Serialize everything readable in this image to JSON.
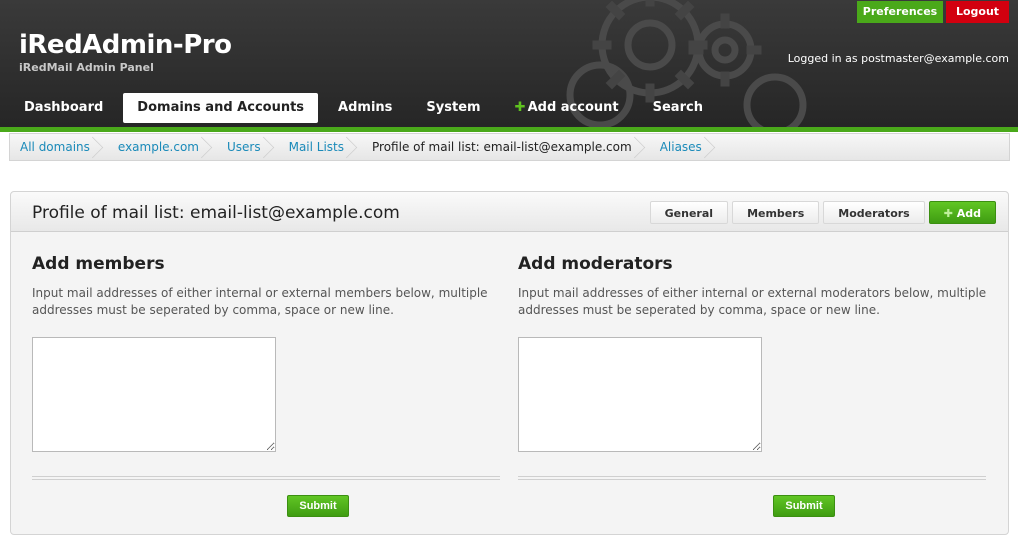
{
  "header": {
    "brand_title": "iRedAdmin-Pro",
    "brand_subtitle": "iRedMail Admin Panel",
    "preferences_label": "Preferences",
    "logout_label": "Logout",
    "logged_in_text": "Logged in as postmaster@example.com",
    "accent_color": "#4aa91a",
    "logout_color": "#d2000f"
  },
  "nav": {
    "items": [
      {
        "label": "Dashboard"
      },
      {
        "label": "Domains and Accounts",
        "active": true
      },
      {
        "label": "Admins"
      },
      {
        "label": "System"
      },
      {
        "label": "Add account",
        "icon": "plus-icon"
      },
      {
        "label": "Search"
      }
    ]
  },
  "breadcrumb": {
    "items": [
      {
        "label": "All domains"
      },
      {
        "label": "example.com"
      },
      {
        "label": "Users"
      },
      {
        "label": "Mail Lists"
      },
      {
        "label": "Profile of mail list: email-list@example.com",
        "current": true
      },
      {
        "label": "Aliases"
      }
    ]
  },
  "main": {
    "title": "Profile of mail list: email-list@example.com",
    "tabs": [
      {
        "label": "General"
      },
      {
        "label": "Members"
      },
      {
        "label": "Moderators"
      },
      {
        "label": "Add",
        "icon": "plus-icon",
        "active": true
      }
    ],
    "members": {
      "title": "Add members",
      "description": "Input mail addresses of either internal or external members below, multiple addresses must be seperated by comma, space or new line.",
      "value": "",
      "submit_label": "Submit"
    },
    "moderators": {
      "title": "Add moderators",
      "description": "Input mail addresses of either internal or external moderators below, multiple addresses must be seperated by comma, space or new line.",
      "value": "",
      "submit_label": "Submit"
    }
  }
}
